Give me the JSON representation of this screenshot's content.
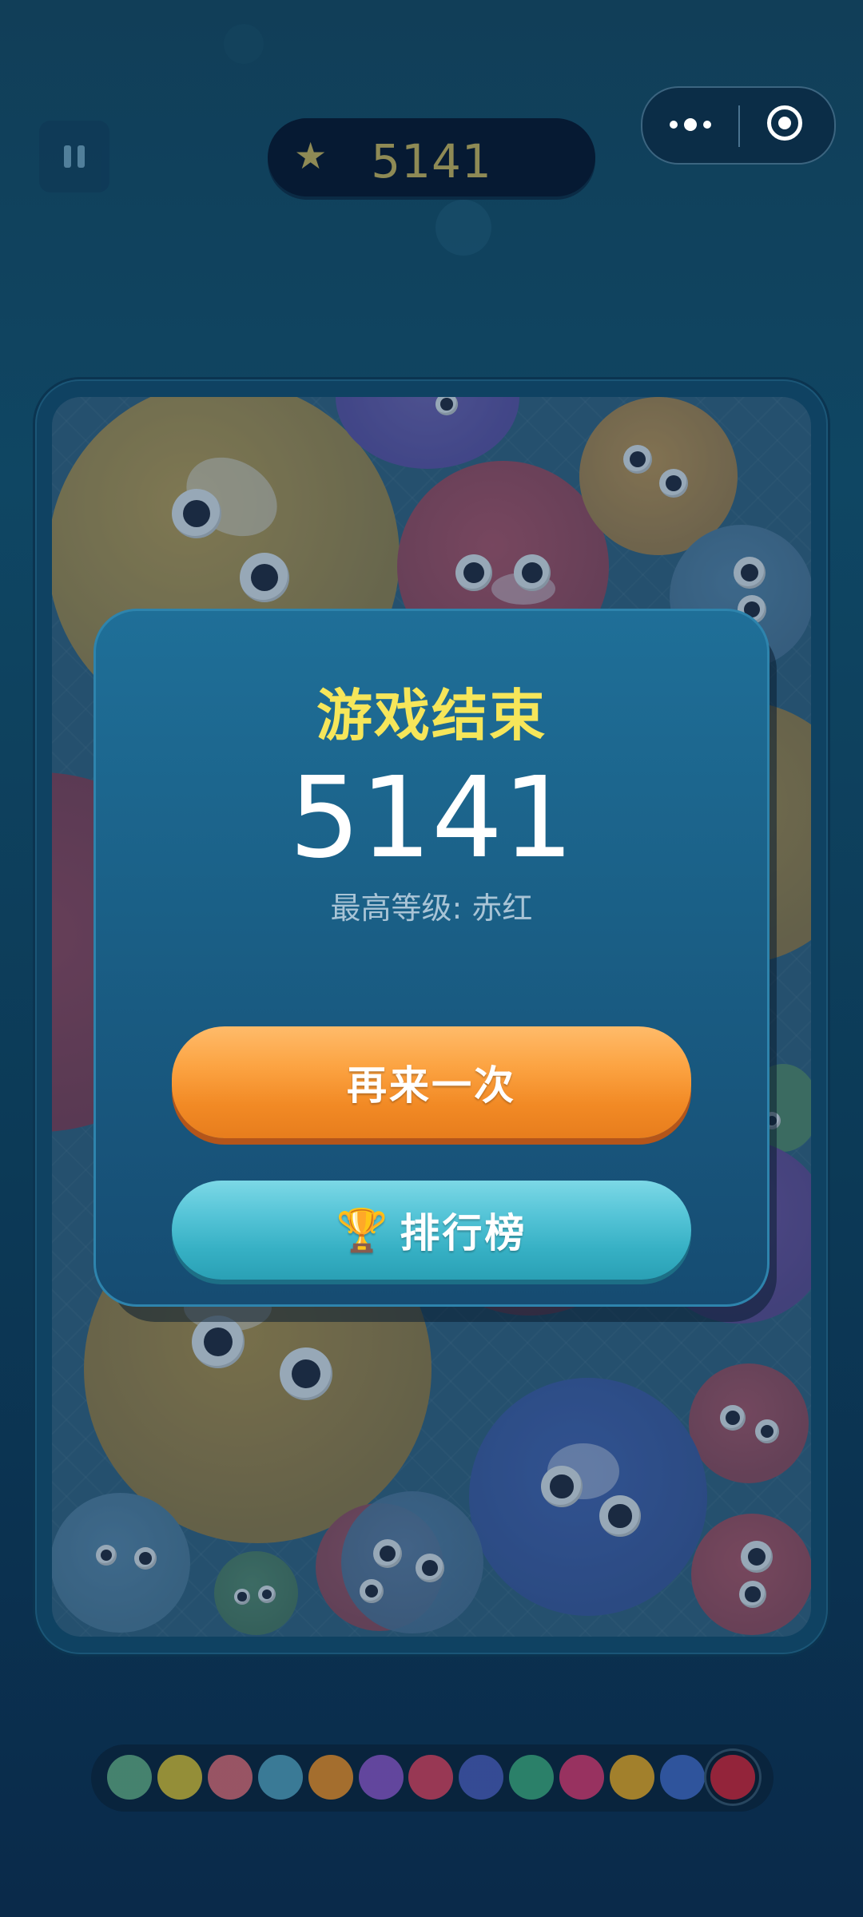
{
  "header": {
    "score": "5141",
    "star_icon": "★"
  },
  "dialog": {
    "title": "游戏结束",
    "score": "5141",
    "highest_level": "最高等级: 赤红",
    "retry_label": "再来一次",
    "leaderboard_label": "排行榜",
    "trophy_icon": "🏆"
  },
  "palette": {
    "colors": [
      "#4c8c74",
      "#a49a38",
      "#a85a68",
      "#3f83a0",
      "#b5762c",
      "#6c4aa8",
      "#a83a56",
      "#3a4f9e",
      "#2f8a6e",
      "#a83364",
      "#b38a2a",
      "#3359a6",
      "#a3243a"
    ],
    "current_index": 12
  }
}
